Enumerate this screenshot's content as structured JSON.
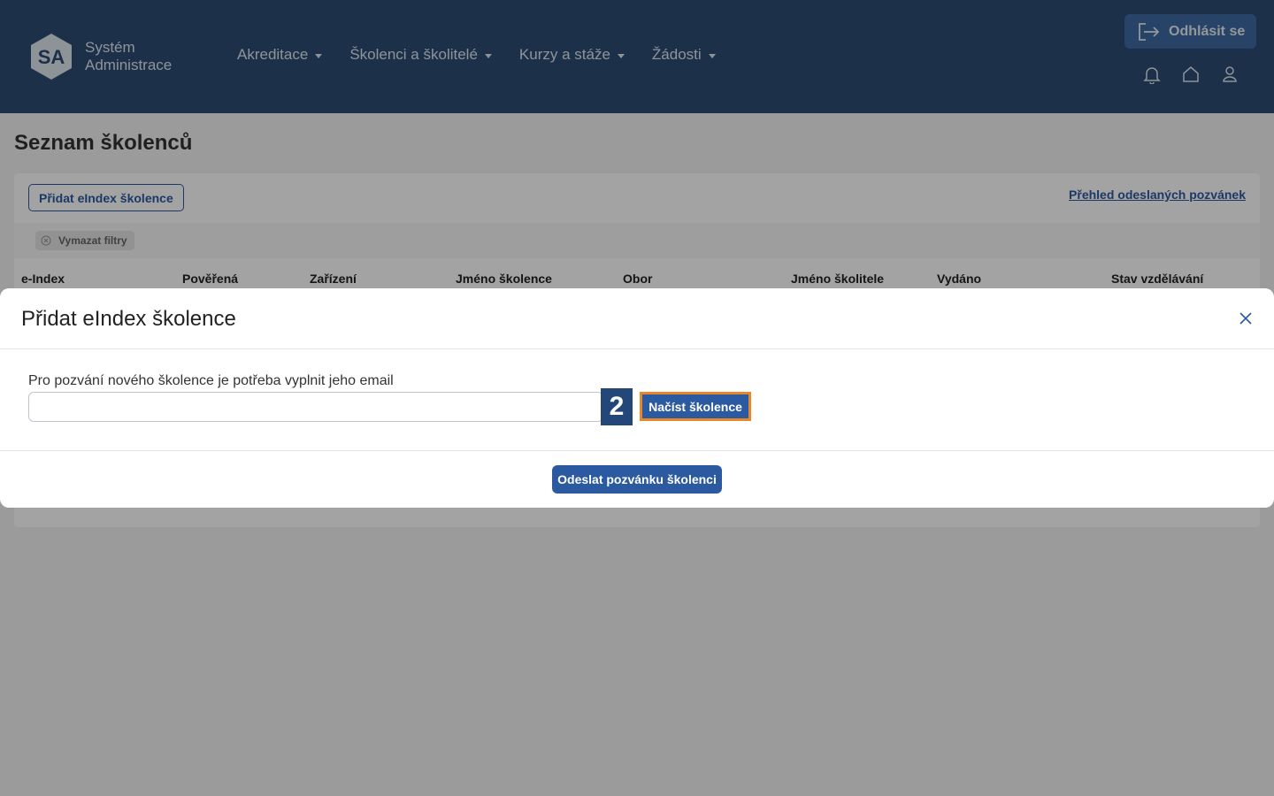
{
  "header": {
    "logo_initials": "SA",
    "logo_line1": "Systém",
    "logo_line2": "Administrace",
    "nav": [
      {
        "label": "Akreditace"
      },
      {
        "label": "Školenci a školitelé"
      },
      {
        "label": "Kurzy a stáže"
      },
      {
        "label": "Žádosti"
      }
    ],
    "logout_label": "Odhlásit se",
    "icons": [
      "bell-icon",
      "home-icon",
      "user-icon"
    ]
  },
  "page": {
    "title": "Seznam školenců",
    "add_button": "Přidat eIndex školence",
    "overview_link": "Přehled odeslaných pozvánek",
    "clear_filters": "Vymazat filtry",
    "columns": [
      "e-Index",
      "Pověřená",
      "Zařízení",
      "Jméno školence",
      "Obor",
      "Jméno školitele",
      "Vydáno",
      "Stav vzdělávání"
    ]
  },
  "modal": {
    "title": "Přidat eIndex školence",
    "field_label": "Pro pozvání nového školence je potřeba vyplnit jeho email",
    "email_value": "",
    "step_badge": "2",
    "load_button": "Načíst školence",
    "send_button": "Odeslat pozvánku školenci"
  },
  "colors": {
    "header_bg": "#2c4b74",
    "primary": "#2c5aa0",
    "highlight": "#e8862a"
  }
}
